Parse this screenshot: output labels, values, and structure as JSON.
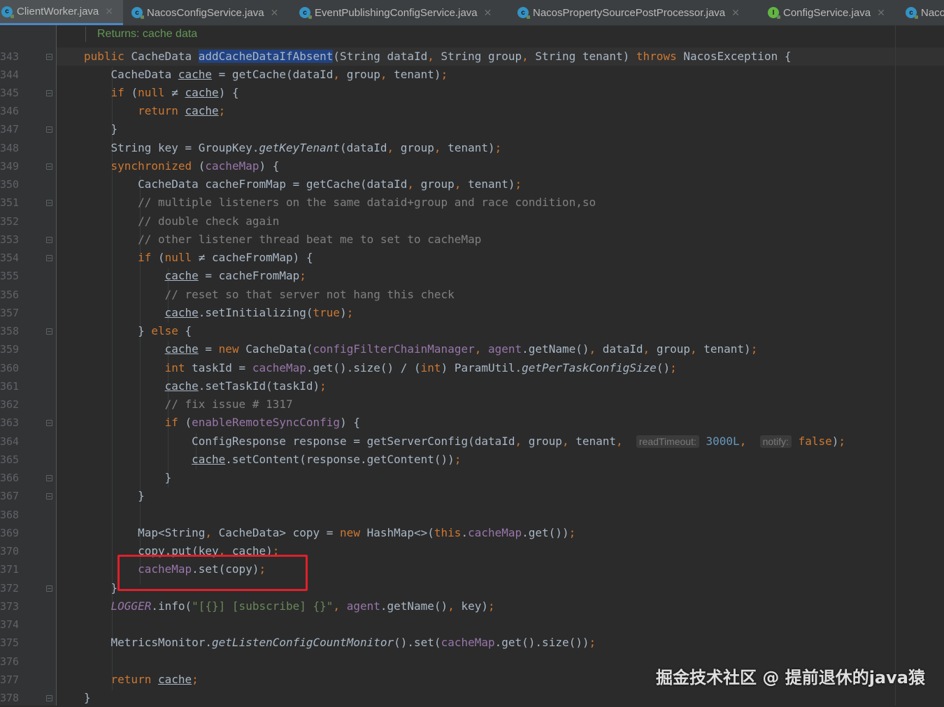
{
  "tabs": [
    {
      "label": "ClientWorker.java",
      "icon": "java-class-icon",
      "active": true
    },
    {
      "label": "NacosConfigService.java",
      "icon": "java-class-icon"
    },
    {
      "label": "EventPublishingConfigService.java",
      "icon": "java-class-icon"
    },
    {
      "label": "NacosPropertySourcePostProcessor.java",
      "icon": "java-class-icon"
    },
    {
      "label": "ConfigService.java",
      "icon": "java-interface-icon"
    },
    {
      "label": "Naco",
      "icon": "java-class-icon"
    }
  ],
  "doc_comment": "Returns: cache data",
  "line_numbers": [
    "343",
    "344",
    "345",
    "346",
    "347",
    "348",
    "349",
    "350",
    "351",
    "352",
    "353",
    "354",
    "355",
    "356",
    "357",
    "358",
    "359",
    "360",
    "361",
    "362",
    "363",
    "364",
    "365",
    "366",
    "367",
    "368",
    "369",
    "370",
    "371",
    "372",
    "373",
    "374",
    "375",
    "376",
    "377",
    "378"
  ],
  "inlay_hints": {
    "read_timeout": "readTimeout:",
    "notify": "notify:"
  },
  "code_lines": [
    "public CacheData addCacheDataIfAbsent(String dataId, String group, String tenant) throws NacosException {",
    "    CacheData cache = getCache(dataId, group, tenant);",
    "    if (null ≠ cache) {",
    "        return cache;",
    "    }",
    "    String key = GroupKey.getKeyTenant(dataId, group, tenant);",
    "    synchronized (cacheMap) {",
    "        CacheData cacheFromMap = getCache(dataId, group, tenant);",
    "        // multiple listeners on the same dataid+group and race condition,so",
    "        // double check again",
    "        // other listener thread beat me to set to cacheMap",
    "        if (null ≠ cacheFromMap) {",
    "            cache = cacheFromMap;",
    "            // reset so that server not hang this check",
    "            cache.setInitializing(true);",
    "        } else {",
    "            cache = new CacheData(configFilterChainManager, agent.getName(), dataId, group, tenant);",
    "            int taskId = cacheMap.get().size() / (int) ParamUtil.getPerTaskConfigSize();",
    "            cache.setTaskId(taskId);",
    "            // fix issue # 1317",
    "            if (enableRemoteSyncConfig) {",
    "                ConfigResponse response = getServerConfig(dataId, group, tenant, readTimeout: 3000L, notify: false);",
    "                cache.setContent(response.getContent());",
    "            }",
    "        }",
    "",
    "        Map<String, CacheData> copy = new HashMap<>(this.cacheMap.get());",
    "        copy.put(key, cache);",
    "        cacheMap.set(copy);",
    "    }",
    "    LOGGER.info(\"[{}] [subscribe] {}\", agent.getName(), key);",
    "",
    "    MetricsMonitor.getListenConfigCountMonitor().set(cacheMap.get().size());",
    "",
    "    return cache;",
    "}"
  ],
  "watermark": "掘金技术社区 @ 提前退休的java猿",
  "colors": {
    "background": "#2b2b2b",
    "keyword": "#cc7832",
    "field": "#9876aa",
    "comment": "#808080",
    "string": "#6a8759",
    "number": "#6897bb",
    "annotation_box": "#e0202a"
  }
}
